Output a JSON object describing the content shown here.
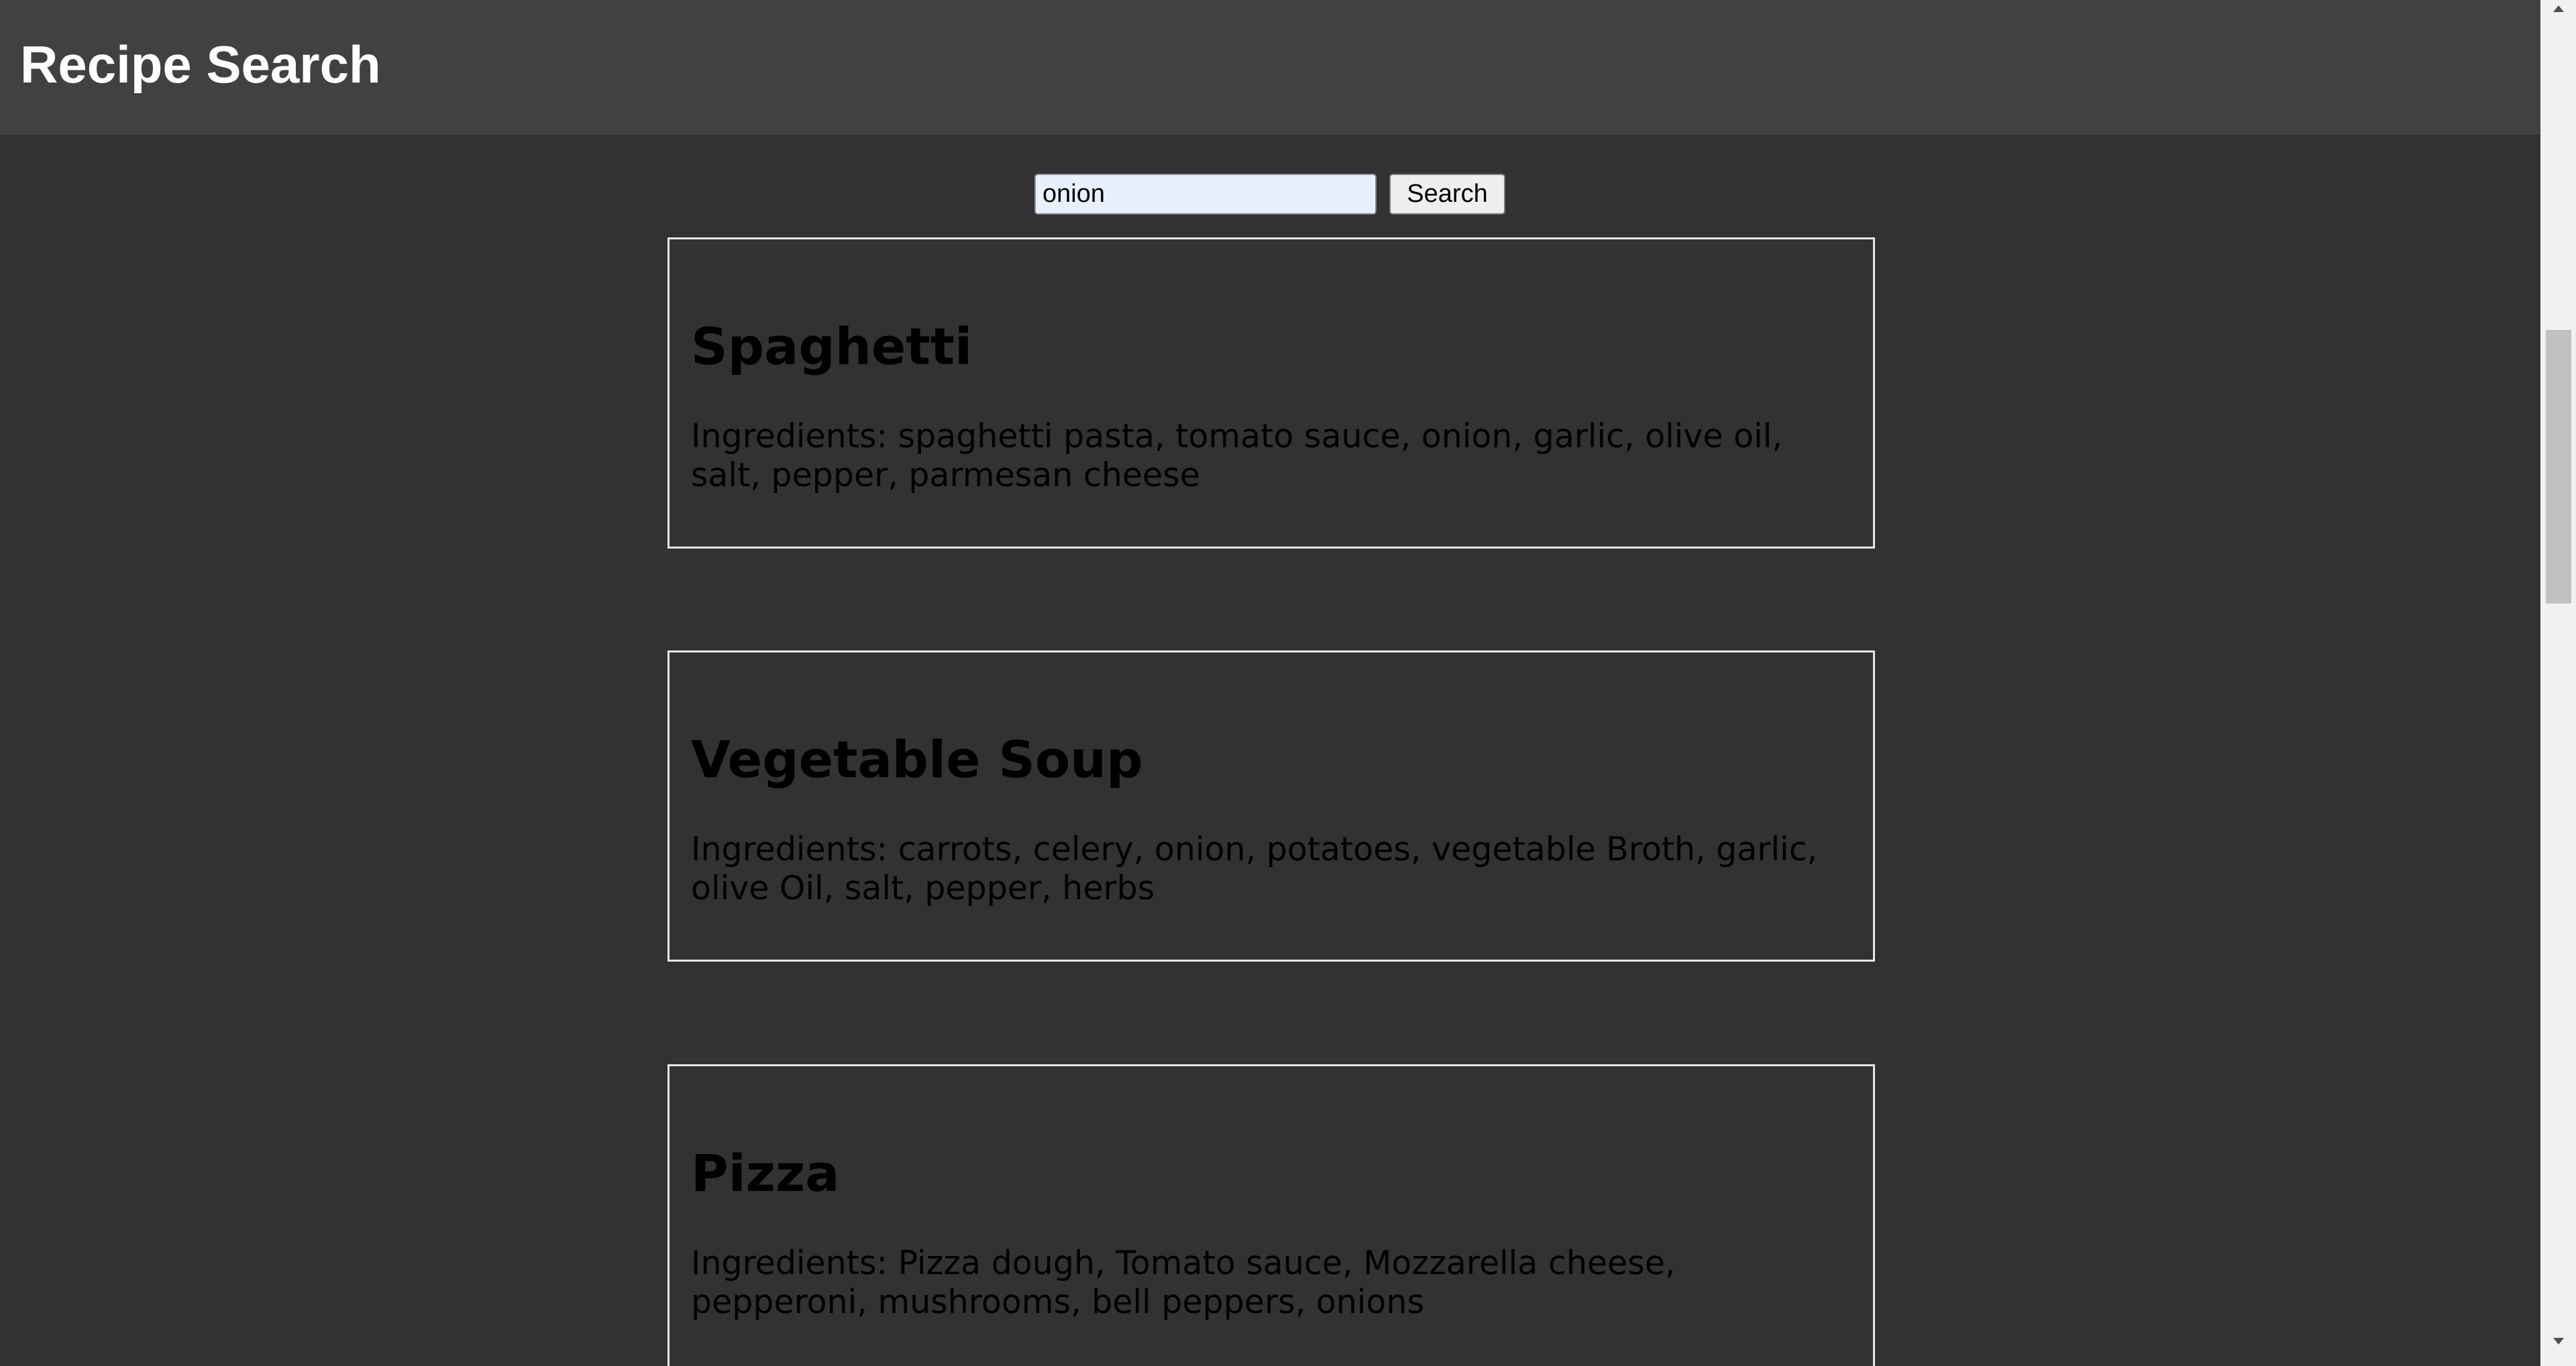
{
  "header": {
    "title": "Recipe Search"
  },
  "search": {
    "value": "onion",
    "button_label": "Search"
  },
  "recipes": [
    {
      "name": "Spaghetti",
      "ingredients": "Ingredients: spaghetti pasta, tomato sauce, onion, garlic, olive oil, salt, pepper, parmesan cheese"
    },
    {
      "name": "Vegetable Soup",
      "ingredients": "Ingredients: carrots, celery, onion, potatoes, vegetable Broth, garlic, olive Oil, salt, pepper, herbs"
    },
    {
      "name": "Pizza",
      "ingredients": "Ingredients: Pizza dough, Tomato sauce, Mozzarella cheese, pepperoni, mushrooms, bell peppers, onions"
    }
  ],
  "icons": {
    "scroll_up": "triangle-up-icon",
    "scroll_down": "triangle-down-icon"
  },
  "colors": {
    "page_background": "#333133",
    "header_background": "#424140",
    "card_border": "#e6e6e6",
    "input_background": "#e8f0fe"
  }
}
